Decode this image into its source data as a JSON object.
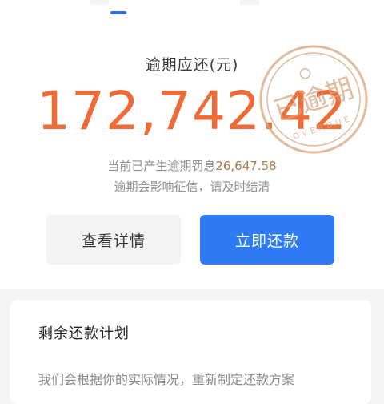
{
  "overdue": {
    "label": "逾期应还(元)",
    "amount": "172,742.42",
    "penalty_prefix": "当前已产生逾期罚息",
    "penalty_amount": "26,647.58",
    "notice": "逾期会影响征信，请及时结清"
  },
  "buttons": {
    "details_label": "查看详情",
    "repay_label": "立即还款"
  },
  "stamp": {
    "text": "已逾期",
    "subtext": "OVERDUE",
    "color": "#d9a27a"
  },
  "plan": {
    "title": "剩余还款计划",
    "description": "我们会根据你的实际情况，重新制定还款方案"
  },
  "colors": {
    "accent_blue": "#2f7bf6",
    "amount_orange": "#ef6a34"
  }
}
